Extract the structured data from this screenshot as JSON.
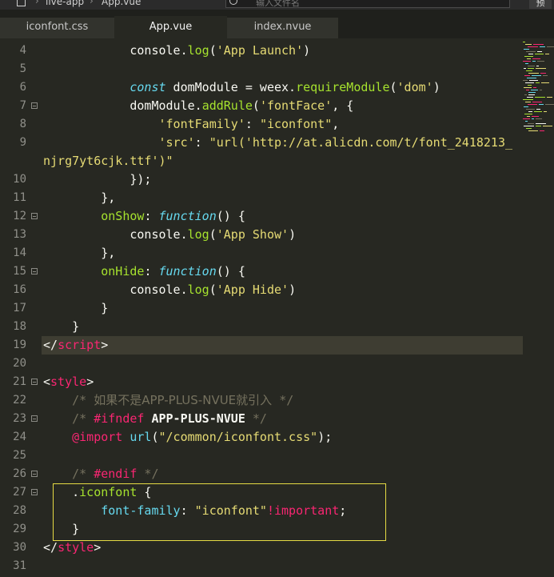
{
  "topbar": {
    "project": "live-app",
    "file": "App.vue",
    "search_placeholder": "输入文件名",
    "side_button": "预"
  },
  "tabs": [
    {
      "label": "iconfont.css",
      "active": false
    },
    {
      "label": "App.vue",
      "active": true
    },
    {
      "label": "index.nvue",
      "active": false
    }
  ],
  "editor": {
    "lines": [
      {
        "num": "4",
        "fold": false,
        "tokens": [
          [
            "w",
            "            console."
          ],
          [
            "f",
            "log"
          ],
          [
            "w",
            "("
          ],
          [
            "s",
            "'App Launch'"
          ],
          [
            "w",
            ")"
          ]
        ]
      },
      {
        "num": "5",
        "fold": false,
        "tokens": []
      },
      {
        "num": "6",
        "fold": false,
        "tokens": [
          [
            "w",
            "            "
          ],
          [
            "k",
            "const"
          ],
          [
            "w",
            " domModule = weex."
          ],
          [
            "f",
            "requireModule"
          ],
          [
            "w",
            "("
          ],
          [
            "s",
            "'dom'"
          ],
          [
            "w",
            ")"
          ]
        ]
      },
      {
        "num": "7",
        "fold": true,
        "tokens": [
          [
            "w",
            "            domModule."
          ],
          [
            "f",
            "addRule"
          ],
          [
            "w",
            "("
          ],
          [
            "s",
            "'fontFace'"
          ],
          [
            "w",
            ", {"
          ]
        ]
      },
      {
        "num": "8",
        "fold": false,
        "tokens": [
          [
            "w",
            "                "
          ],
          [
            "s",
            "'fontFamily'"
          ],
          [
            "w",
            ": "
          ],
          [
            "s",
            "\"iconfont\""
          ],
          [
            "w",
            ","
          ]
        ]
      },
      {
        "num": "9",
        "fold": false,
        "tokens": [
          [
            "w",
            "                "
          ],
          [
            "s",
            "'src'"
          ],
          [
            "w",
            ": "
          ],
          [
            "s",
            "\"url('http://at.alicdn.com/t/font_2418213_"
          ]
        ]
      },
      {
        "num": "",
        "fold": false,
        "tokens": [
          [
            "s",
            "njrg7yt6cjk.ttf')\""
          ]
        ]
      },
      {
        "num": "10",
        "fold": false,
        "tokens": [
          [
            "w",
            "            });"
          ]
        ]
      },
      {
        "num": "11",
        "fold": false,
        "tokens": [
          [
            "w",
            "        },"
          ]
        ]
      },
      {
        "num": "12",
        "fold": true,
        "tokens": [
          [
            "w",
            "        "
          ],
          [
            "a",
            "onShow"
          ],
          [
            "w",
            ": "
          ],
          [
            "k",
            "function"
          ],
          [
            "w",
            "() {"
          ]
        ]
      },
      {
        "num": "13",
        "fold": false,
        "tokens": [
          [
            "w",
            "            console."
          ],
          [
            "f",
            "log"
          ],
          [
            "w",
            "("
          ],
          [
            "s",
            "'App Show'"
          ],
          [
            "w",
            ")"
          ]
        ]
      },
      {
        "num": "14",
        "fold": false,
        "tokens": [
          [
            "w",
            "        },"
          ]
        ]
      },
      {
        "num": "15",
        "fold": true,
        "tokens": [
          [
            "w",
            "        "
          ],
          [
            "a",
            "onHide"
          ],
          [
            "w",
            ": "
          ],
          [
            "k",
            "function"
          ],
          [
            "w",
            "() {"
          ]
        ]
      },
      {
        "num": "16",
        "fold": false,
        "tokens": [
          [
            "w",
            "            console."
          ],
          [
            "f",
            "log"
          ],
          [
            "w",
            "("
          ],
          [
            "s",
            "'App Hide'"
          ],
          [
            "w",
            ")"
          ]
        ]
      },
      {
        "num": "17",
        "fold": false,
        "tokens": [
          [
            "w",
            "        }"
          ]
        ]
      },
      {
        "num": "18",
        "fold": false,
        "tokens": [
          [
            "w",
            "    }"
          ]
        ]
      },
      {
        "num": "19",
        "fold": false,
        "current": true,
        "tokens": [
          [
            "w",
            "</"
          ],
          [
            "t",
            "script"
          ],
          [
            "w",
            ">"
          ]
        ]
      },
      {
        "num": "20",
        "fold": false,
        "tokens": []
      },
      {
        "num": "21",
        "fold": true,
        "tokens": [
          [
            "w",
            "<"
          ],
          [
            "t",
            "style"
          ],
          [
            "w",
            ">"
          ]
        ]
      },
      {
        "num": "22",
        "fold": false,
        "tokens": [
          [
            "c",
            "    /* "
          ],
          [
            "cjk",
            "如果不是APP-PLUS-NVUE就引入"
          ],
          [
            "c",
            " */"
          ]
        ]
      },
      {
        "num": "23",
        "fold": true,
        "tokens": [
          [
            "c",
            "    /* "
          ],
          [
            "o",
            "#ifndef"
          ],
          [
            "w",
            " "
          ],
          [
            "b",
            "APP-PLUS-NVUE"
          ],
          [
            "c",
            " */"
          ]
        ]
      },
      {
        "num": "24",
        "fold": false,
        "tokens": [
          [
            "w",
            "    "
          ],
          [
            "o",
            "@import"
          ],
          [
            "w",
            " "
          ],
          [
            "i",
            "url"
          ],
          [
            "w",
            "("
          ],
          [
            "s",
            "\"/common/iconfont.css\""
          ],
          [
            "w",
            ");"
          ]
        ]
      },
      {
        "num": "25",
        "fold": false,
        "tokens": []
      },
      {
        "num": "26",
        "fold": true,
        "tokens": [
          [
            "c",
            "    /* "
          ],
          [
            "o",
            "#endif"
          ],
          [
            "c",
            " */"
          ]
        ]
      },
      {
        "num": "27",
        "fold": true,
        "tokens": [
          [
            "w",
            "    ."
          ],
          [
            "a",
            "iconfont"
          ],
          [
            "w",
            " {"
          ]
        ]
      },
      {
        "num": "28",
        "fold": false,
        "tokens": [
          [
            "w",
            "        "
          ],
          [
            "i",
            "font-family"
          ],
          [
            "w",
            ": "
          ],
          [
            "s",
            "\"iconfont\""
          ],
          [
            "o",
            "!important"
          ],
          [
            "w",
            ";"
          ]
        ]
      },
      {
        "num": "29",
        "fold": false,
        "tokens": [
          [
            "w",
            "    }"
          ]
        ]
      },
      {
        "num": "30",
        "fold": false,
        "tokens": [
          [
            "w",
            "</"
          ],
          [
            "t",
            "style"
          ],
          [
            "w",
            ">"
          ]
        ]
      },
      {
        "num": "31",
        "fold": false,
        "tokens": []
      }
    ]
  },
  "colors": {
    "background": "#272822",
    "keyword": "#66d9ef",
    "string": "#e6db74",
    "tag": "#f92672",
    "function": "#a6e22e",
    "comment": "#75715e",
    "highlight_box": "#e6db44"
  }
}
